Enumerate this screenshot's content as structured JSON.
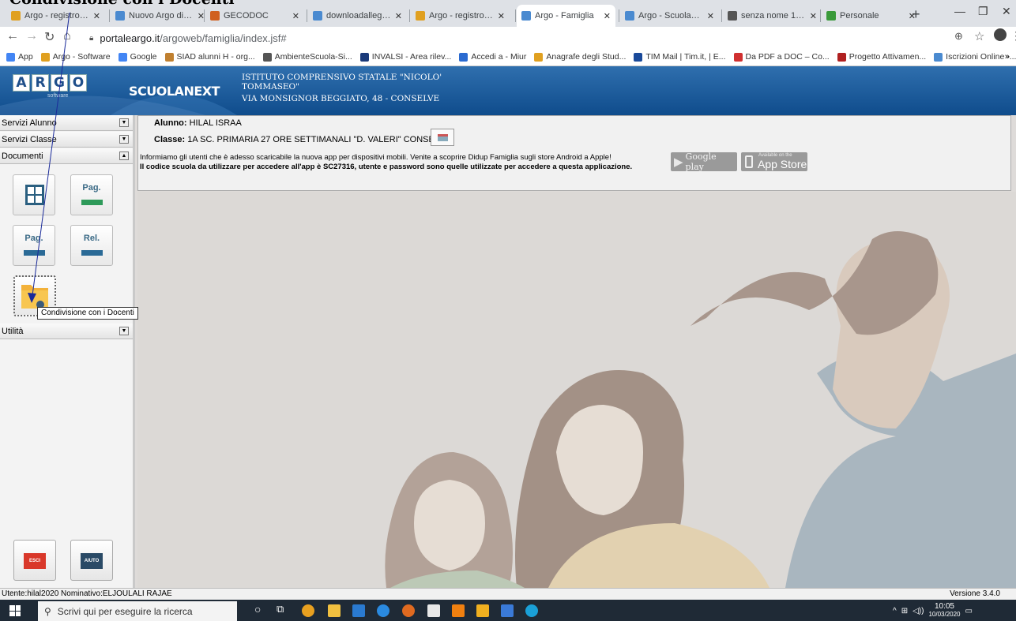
{
  "annotation": {
    "cut_title": "Condivisione con i Docenti"
  },
  "browser": {
    "tabs": [
      {
        "label": "Argo - registro ele",
        "color": "#e0a020",
        "active": false
      },
      {
        "label": "Nuovo Argo didUp",
        "color": "#4a8ad0",
        "active": false
      },
      {
        "label": "GECODOC",
        "color": "#d06020",
        "active": false
      },
      {
        "label": "downloadallegato",
        "color": "#4a8ad0",
        "active": false
      },
      {
        "label": "Argo - registro ele",
        "color": "#e0a020",
        "active": false
      },
      {
        "label": "Argo - Famiglia",
        "color": "#4a8ad0",
        "active": true
      },
      {
        "label": "Argo - ScuolaNext",
        "color": "#4a8ad0",
        "active": false
      },
      {
        "label": "senza nome 1.pdf",
        "color": "#555555",
        "active": false
      },
      {
        "label": "Personale",
        "color": "#3a9a3a",
        "active": false
      }
    ],
    "new_tab": "+",
    "url_host": "portaleargo.it",
    "url_path": "/argoweb/famiglia/index.jsf#",
    "bookmarks": [
      {
        "label": "App",
        "color": "#4285f4"
      },
      {
        "label": "Argo - Software",
        "color": "#e0a020"
      },
      {
        "label": "Google",
        "color": "#4285f4"
      },
      {
        "label": "SIAD alunni H - org...",
        "color": "#c08030"
      },
      {
        "label": "AmbienteScuola-Si...",
        "color": "#555555"
      },
      {
        "label": "INVALSI - Area rilev...",
        "color": "#1a3a7a"
      },
      {
        "label": "Accedi a - Miur",
        "color": "#2a6ad0"
      },
      {
        "label": "Anagrafe degli Stud...",
        "color": "#e0a020"
      },
      {
        "label": "TIM Mail | Tim.it, | E...",
        "color": "#1a4a9a"
      },
      {
        "label": "Da PDF a DOC – Co...",
        "color": "#d03030"
      },
      {
        "label": "Progetto Attivamen...",
        "color": "#b02020"
      },
      {
        "label": "Iscrizioni Online -...",
        "color": "#4a8ad0"
      }
    ],
    "bookmarks_more": "»"
  },
  "header": {
    "logo_letters": [
      "A",
      "R",
      "G",
      "O"
    ],
    "logo_sub": "software",
    "product": "SCUOLANEXT",
    "school_lines": [
      "ISTITUTO COMPRENSIVO STATALE \"NICOLO'",
      "TOMMASEO\"",
      "VIA MONSIGNOR BEGGIATO, 48 - CONSELVE"
    ]
  },
  "sidebar": {
    "sections": [
      "Servizi Alunno",
      "Servizi Classe",
      "Documenti",
      "Utilità"
    ],
    "doc_icons": [
      {
        "label": "",
        "name": "bacheca-icon"
      },
      {
        "label": "Pag.",
        "name": "pagella-icon"
      },
      {
        "label": "Pag.",
        "name": "pagella-2-icon"
      },
      {
        "label": "Rel.",
        "name": "relazione-icon"
      },
      {
        "label": "",
        "name": "folder-share-icon"
      }
    ],
    "tooltip": "Condivisione con i Docenti",
    "exit_label": "ESCI",
    "help_label": "AIUTO"
  },
  "info": {
    "alunno_label": "Alunno:",
    "alunno_value": "HILAL ISRAA",
    "classe_label": "Classe:",
    "classe_value": "1A SC. PRIMARIA 27 ORE SETTIMANALI \"D. VALERI\" CONSELVE",
    "notice_line1": "Informiamo gli utenti che è adesso scaricabile la nuova app per dispositivi mobili. Venite a scoprire Didup Famiglia sugli store Android a Apple!",
    "notice_line2": "Il codice scuola da utilizzare per accedere all'app è SC27316, utente e password sono quelle utilizzate per accedere a questa applicazione.",
    "google_play": "Google play",
    "app_store_small": "Available on the",
    "app_store": "App Store"
  },
  "status": {
    "user": "Utente:hilal2020 Nominativo:ELJOULALI RAJAE",
    "version": "Versione 3.4.0"
  },
  "taskbar": {
    "search_placeholder": "Scrivi qui per eseguire la ricerca",
    "time": "10:05",
    "date": "10/03/2020"
  }
}
